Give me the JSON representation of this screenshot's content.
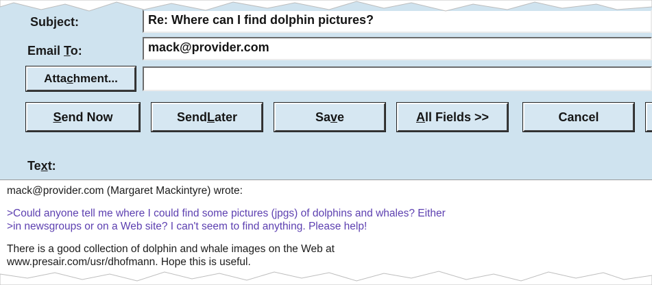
{
  "form": {
    "subject_label_pre": "Sub",
    "subject_label_ul": "j",
    "subject_label_post": "ect:",
    "subject_value": "Re: Where can I find dolphin pictures?",
    "email_to_label_pre": "Email ",
    "email_to_label_ul": "T",
    "email_to_label_post": "o:",
    "email_to_value": "mack@provider.com",
    "attachment_button_pre": "Atta",
    "attachment_button_ul": "c",
    "attachment_button_post": "hment...",
    "attachment_value": "",
    "text_label_pre": "Te",
    "text_label_ul": "x",
    "text_label_post": "t:"
  },
  "buttons": [
    {
      "pre": "",
      "ul": "S",
      "post": "end Now"
    },
    {
      "pre": "Send ",
      "ul": "L",
      "post": "ater"
    },
    {
      "pre": "Sa",
      "ul": "v",
      "post": "e"
    },
    {
      "pre": "",
      "ul": "A",
      "post": "ll Fields >>"
    },
    {
      "pre": "",
      "ul": "",
      "post": "Cancel"
    }
  ],
  "message": {
    "header": "mack@provider.com (Margaret Mackintyre) wrote:",
    "quoted_lines": [
      ">Could anyone tell me where I could find some pictures (jpgs) of dolphins and whales?  Either",
      ">in newsgroups or on a Web site? I can't seem to find anything. Please help!"
    ],
    "reply_lines": [
      "There is a good collection of dolphin and whale images on the Web at",
      "www.presair.com/usr/dhofmann. Hope this is useful."
    ]
  },
  "colors": {
    "form_background": "#cfe3ef",
    "quoted_text": "#5c3fb0"
  }
}
